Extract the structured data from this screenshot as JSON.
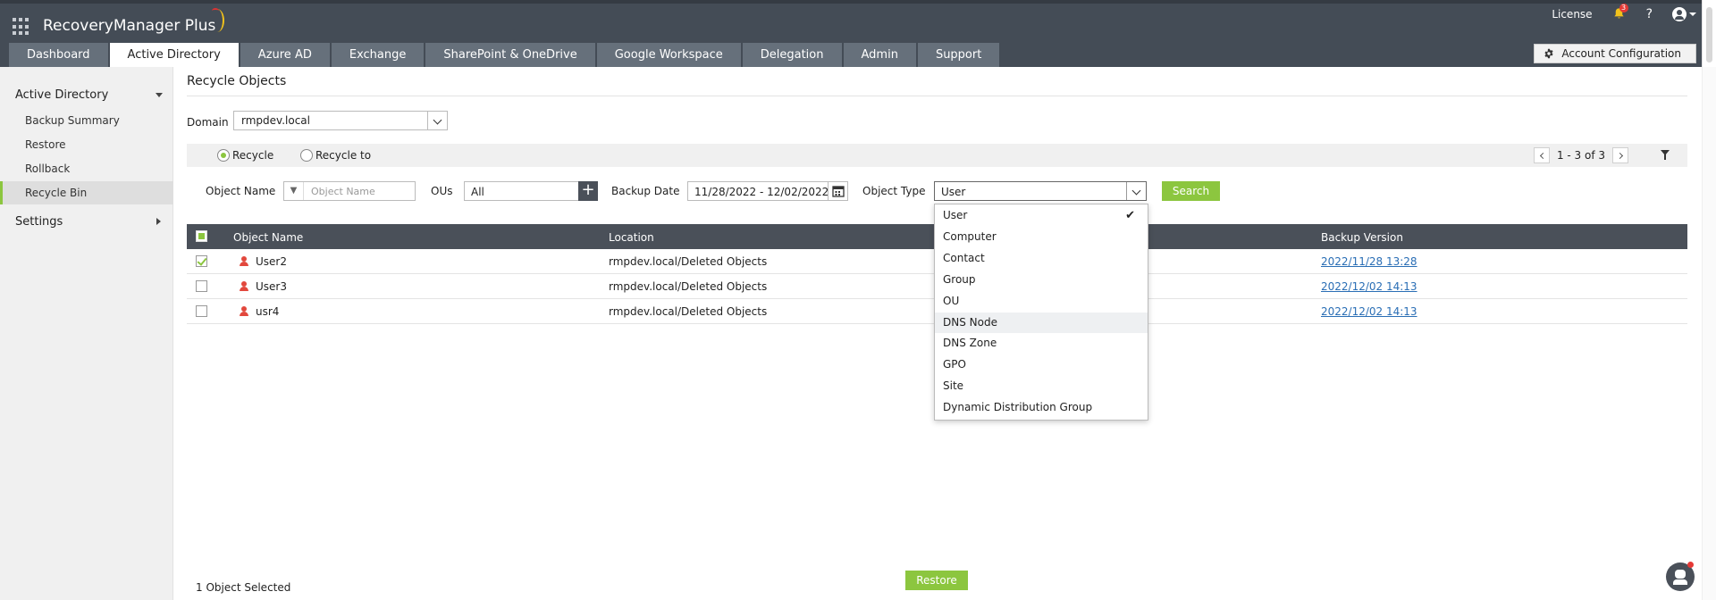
{
  "app": {
    "logo_text": "RecoveryManager Plus",
    "license_label": "License",
    "notification_count": "3",
    "help_label": "?",
    "account_config_label": "Account Configuration"
  },
  "tabs": [
    {
      "label": "Dashboard",
      "active": false
    },
    {
      "label": "Active Directory",
      "active": true
    },
    {
      "label": "Azure AD",
      "active": false
    },
    {
      "label": "Exchange",
      "active": false
    },
    {
      "label": "SharePoint & OneDrive",
      "active": false
    },
    {
      "label": "Google Workspace",
      "active": false
    },
    {
      "label": "Delegation",
      "active": false
    },
    {
      "label": "Admin",
      "active": false
    },
    {
      "label": "Support",
      "active": false
    }
  ],
  "sidebar": {
    "section_title": "Active Directory",
    "items": [
      {
        "label": "Backup Summary"
      },
      {
        "label": "Restore"
      },
      {
        "label": "Rollback"
      },
      {
        "label": "Recycle Bin",
        "active": true
      }
    ],
    "settings_label": "Settings"
  },
  "page": {
    "title": "Recycle Objects",
    "domain_label": "Domain",
    "domain_value": "rmpdev.local",
    "radio_recycle": "Recycle",
    "radio_recycle_to": "Recycle to",
    "pager_text": "1 - 3 of 3"
  },
  "filters": {
    "object_name_label": "Object Name",
    "object_name_placeholder": "Object Name",
    "ous_label": "OUs",
    "ous_value": "All",
    "backup_date_label": "Backup Date",
    "backup_date_value": "11/28/2022 - 12/02/2022",
    "object_type_label": "Object Type",
    "object_type_value": "User",
    "search_label": "Search"
  },
  "table": {
    "headers": {
      "object_name": "Object Name",
      "location": "Location",
      "backup_version": "Backup Version"
    },
    "rows": [
      {
        "checked": true,
        "name": "User2",
        "location": "rmpdev.local/Deleted Objects",
        "backup_version": "2022/11/28 13:28"
      },
      {
        "checked": false,
        "name": "User3",
        "location": "rmpdev.local/Deleted Objects",
        "backup_version": "2022/12/02 14:13"
      },
      {
        "checked": false,
        "name": "usr4",
        "location": "rmpdev.local/Deleted Objects",
        "backup_version": "2022/12/02 14:13"
      }
    ]
  },
  "object_type_options": [
    {
      "label": "User",
      "selected": true
    },
    {
      "label": "Computer"
    },
    {
      "label": "Contact"
    },
    {
      "label": "Group"
    },
    {
      "label": "OU"
    },
    {
      "label": "DNS Node",
      "hover": true
    },
    {
      "label": "DNS Zone"
    },
    {
      "label": "GPO"
    },
    {
      "label": "Site"
    },
    {
      "label": "Dynamic Distribution Group"
    }
  ],
  "footer": {
    "selected_text": "1 Object Selected",
    "restore_label": "Restore"
  },
  "colors": {
    "header_bg": "#444c56",
    "accent_green": "#8cc63f",
    "table_header_bg": "#4a5059",
    "link_blue": "#2a6eb5",
    "user_icon_red": "#e2483d"
  }
}
